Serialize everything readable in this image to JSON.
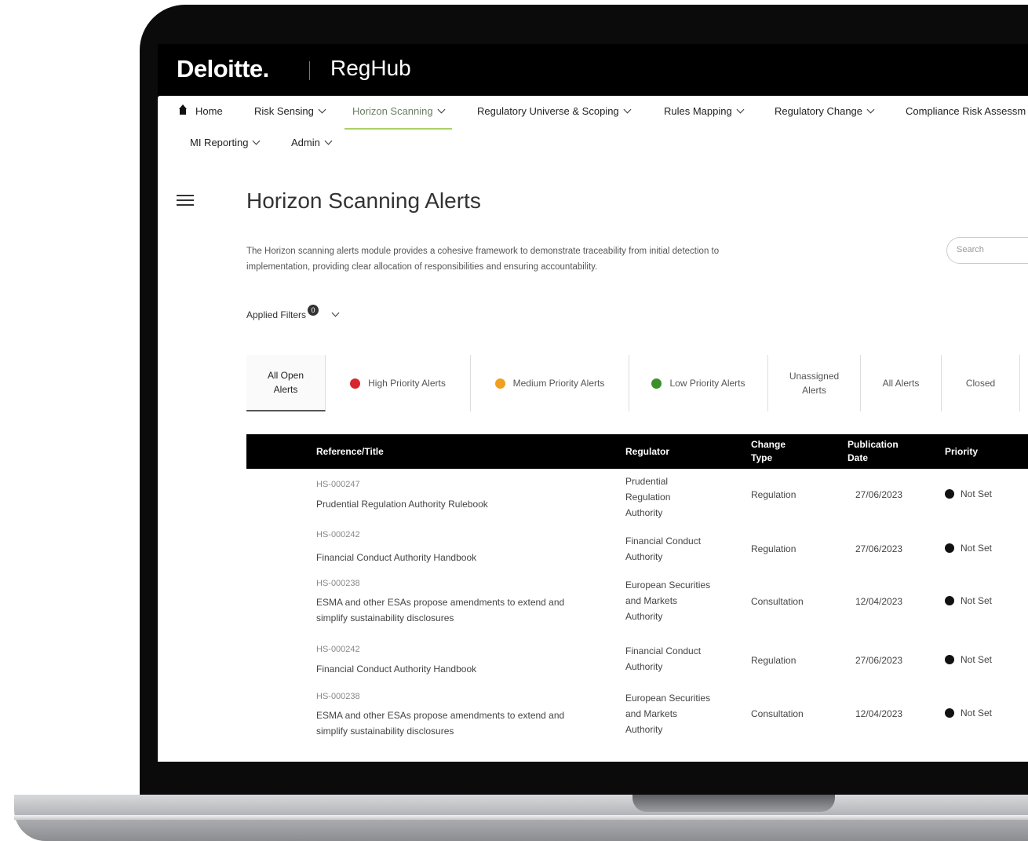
{
  "brand": {
    "logo": "Deloitte.",
    "product": "RegHub"
  },
  "nav": {
    "home": "Home",
    "items": [
      {
        "label": "Risk Sensing"
      },
      {
        "label": "Horizon Scanning"
      },
      {
        "label": "Regulatory Universe & Scoping"
      },
      {
        "label": "Rules Mapping"
      },
      {
        "label": "Regulatory Change"
      },
      {
        "label": "Compliance Risk Assessm"
      },
      {
        "label": "MI Reporting"
      },
      {
        "label": "Admin"
      }
    ],
    "active_index": 1
  },
  "page": {
    "title": "Horizon Scanning Alerts",
    "description": "The Horizon scanning alerts module provides a cohesive framework to demonstrate traceability from initial detection to implementation, providing clear allocation of responsibilities and ensuring accountability.",
    "search_placeholder": "Search",
    "applied_filters": "Applied Filters",
    "filter_count": "0"
  },
  "tabs": [
    {
      "label": "All Open Alerts",
      "dot": ""
    },
    {
      "label": "High Priority Alerts",
      "dot": "#d9262e"
    },
    {
      "label": "Medium Priority Alerts",
      "dot": "#f0a01e"
    },
    {
      "label": "Low Priority Alerts",
      "dot": "#3a8f2a"
    },
    {
      "label": "Unassigned Alerts",
      "dot": ""
    },
    {
      "label": "All Alerts",
      "dot": ""
    },
    {
      "label": "Closed",
      "dot": ""
    }
  ],
  "table": {
    "headers": [
      "Reference/Title",
      "Regulator",
      "Change Type",
      "Publication Date",
      "Priority"
    ],
    "rows": [
      {
        "ref": "HS-000247",
        "title": "Prudential Regulation Authority Rulebook",
        "regulator": "Prudential Regulation Authority",
        "change_type": "Regulation",
        "date": "27/06/2023",
        "priority": "Not Set"
      },
      {
        "ref": "HS-000242",
        "title": "Financial Conduct Authority Handbook",
        "regulator": "Financial Conduct Authority",
        "change_type": "Regulation",
        "date": "27/06/2023",
        "priority": "Not Set"
      },
      {
        "ref": "HS-000238",
        "title": "ESMA and other ESAs propose amendments to extend and simplify sustainability disclosures",
        "regulator": "European Securities and Markets Authority",
        "change_type": "Consultation",
        "date": "12/04/2023",
        "priority": "Not Set"
      },
      {
        "ref": "HS-000242",
        "title": "Financial Conduct Authority Handbook",
        "regulator": "Financial Conduct Authority",
        "change_type": "Regulation",
        "date": "27/06/2023",
        "priority": "Not Set"
      },
      {
        "ref": "HS-000238",
        "title": "ESMA and other ESAs propose amendments to extend and simplify sustainability disclosures",
        "regulator": "European Securities and Markets Authority",
        "change_type": "Consultation",
        "date": "12/04/2023",
        "priority": "Not Set"
      }
    ]
  }
}
